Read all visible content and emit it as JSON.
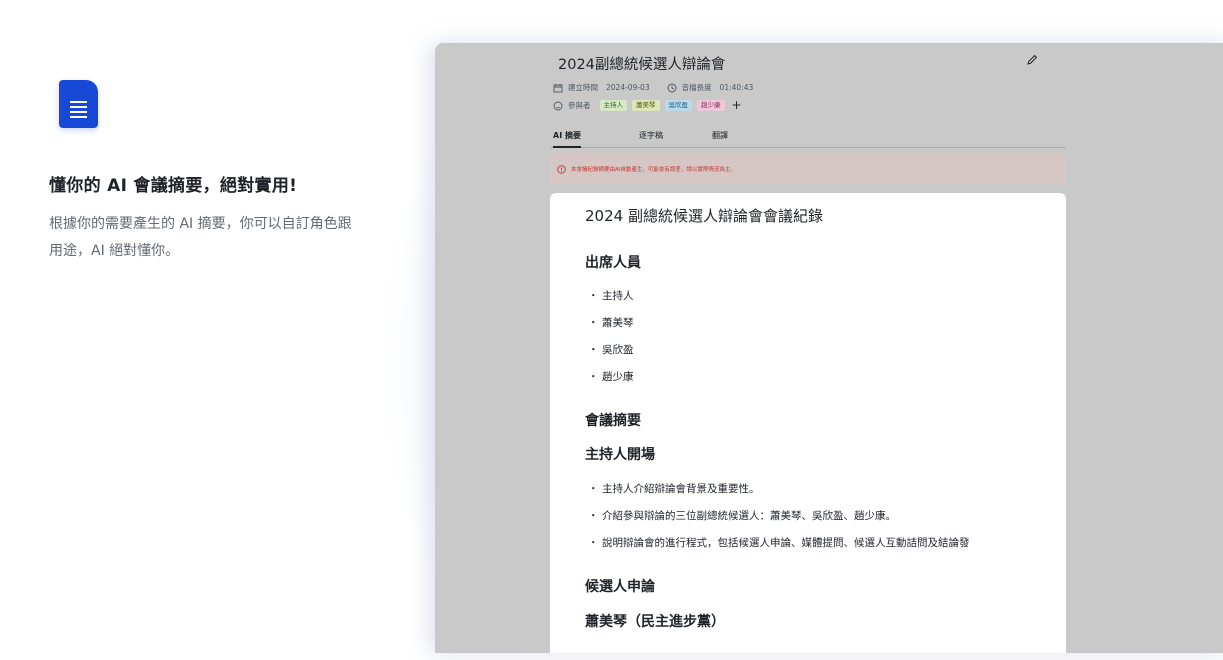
{
  "promo": {
    "headline": "懂你的 AI 會議摘要，絕對實用!",
    "body": "根據你的需要產生的 AI 摘要，你可以自訂角色跟用途，AI 絕對懂你。",
    "logo_icon": "document-icon",
    "brand_color": "#1749d6"
  },
  "meeting": {
    "title": "2024副總統候選人辯論會",
    "created_label": "建立時間",
    "created_value": "2024-09-03",
    "duration_label": "音檔長度",
    "duration_value": "01:40:43",
    "participants_label": "參與者",
    "participants": [
      "主持人",
      "蕭美琴",
      "吳欣盈",
      "趙少康"
    ],
    "add_label": "+"
  },
  "tabs": [
    {
      "label": "AI 摘要",
      "active": true
    },
    {
      "label": "逐字稿",
      "active": false
    },
    {
      "label": "翻譯",
      "active": false
    }
  ],
  "warning": {
    "text": "本會議紀錄摘要由AI自動產生，可能會有誤差，請以實際情況為主。",
    "color": "#c0392b"
  },
  "document": {
    "title": "2024 副總統候選人辯論會會議紀錄",
    "attendees_heading": "出席人員",
    "attendees": [
      "主持人",
      "蕭美琴",
      "吳欣盈",
      "趙少康"
    ],
    "summary_heading": "會議摘要",
    "opening_heading": "主持人開場",
    "opening_items": [
      "主持人介紹辯論會背景及重要性。",
      "介紹參與辯論的三位副總統候選人：蕭美琴、吳欣盈、趙少康。",
      "說明辯論會的進行程式，包括候選人申論、媒體提問、候選人互動詰問及結論發"
    ],
    "statements_heading": "候選人申論",
    "candidate_heading": "蕭美琴（民主進步黨）"
  }
}
